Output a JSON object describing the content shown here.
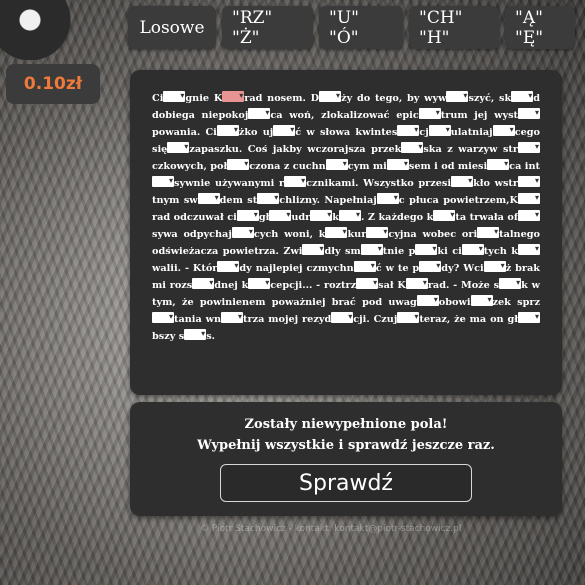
{
  "tabs": [
    "Losowe",
    "\"RZ\" \"Ż\"",
    "\"U\" \"Ó\"",
    "\"CH\" \"H\"",
    "\"Ą\" \"Ę\""
  ],
  "price": "0.10zł",
  "text": {
    "parts": [
      "Ci",
      "gnie K",
      "rad nosem. D",
      "ży do tego, by wyw",
      "szyć, sk",
      "d dobiega niepokoj",
      "ca woń, zlokalizować epic",
      "trum jej wyst",
      "powania. Ci",
      "żko uj",
      "ć w słowa kwintes",
      "cj",
      "ulatniaj",
      "cego się",
      "zapaszku. Coś jakby wczorajsza przek",
      "ska z warzyw str",
      "czkowych, poł",
      "czona z cuchn",
      "cym mi",
      "sem i od miesi",
      "ca int",
      "sywnie używanymi r",
      "cznikami. Wszystko przesi",
      "kło wstr",
      "tnym sw",
      "dem st",
      "chlizny. Napełniaj",
      "c płuca powietrzem,K",
      "rad odczuwał ci",
      "gł",
      "udr",
      "k",
      ". Z każdego k",
      "ta trwała of",
      "sywa odpychaj",
      "cych woni, k",
      "kur",
      "cyjna wobec ori",
      "talnego odświeżacza powietrza. Zwi",
      "dły sm",
      "tnie p",
      "ki ci",
      "tych k",
      "walii. - Któr",
      "dy najlepiej czmychn",
      "ć w te p",
      "dy? Wci",
      "ż brak mi rozs",
      "dnej k",
      "cepcji... - roztrz",
      "sał K",
      "rad. - Może s",
      "k w tym, że powinienem poważniej brać pod uwag",
      "obowi",
      "zek sprz",
      "tania wn",
      "trza mojej rezyd",
      "cji. Czuj",
      "teraz, że ma on gł",
      "bszy s",
      "s."
    ]
  },
  "result": {
    "line1": "Zostały niewypełnione pola!",
    "line2": "Wypełnij wszystkie i sprawdź jeszcze raz.",
    "button": "Sprawdź"
  },
  "footer": "© Piotr Stachowicz - kontakt: kontakt@piotr-stachowicz.pl"
}
